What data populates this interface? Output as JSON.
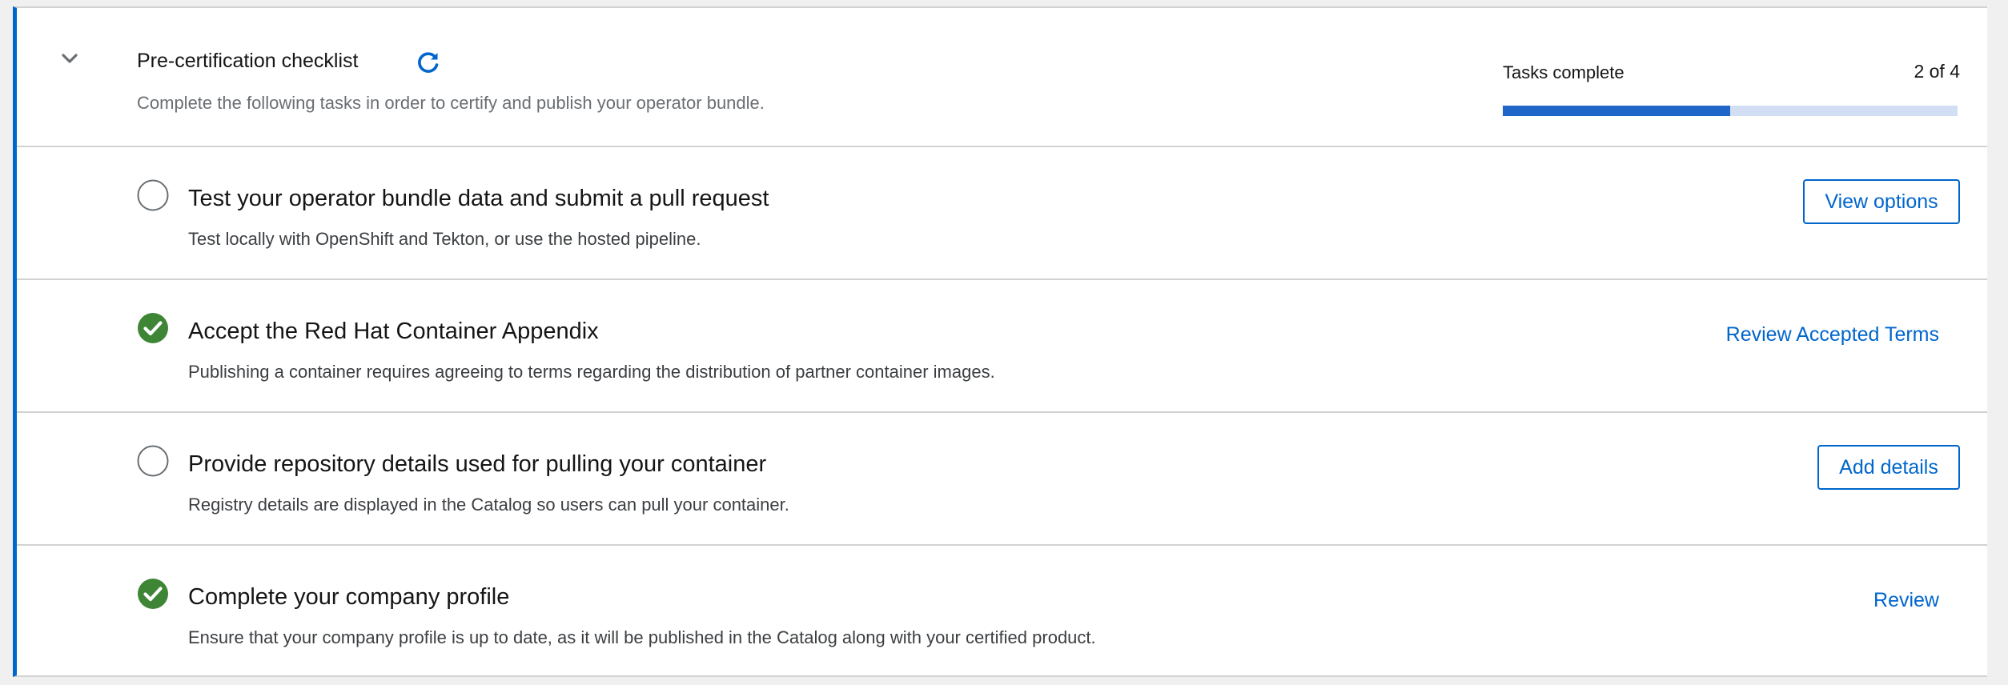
{
  "checklist": {
    "title": "Pre-certification checklist",
    "subtitle": "Complete the following tasks in order to certify and publish your operator bundle.",
    "toggle_icon": "chevron-down-icon",
    "refresh_icon": "refresh-icon",
    "progress": {
      "label": "Tasks complete",
      "count_text": "2 of 4",
      "completed": 2,
      "total": 4
    }
  },
  "tasks": [
    {
      "title": "Test your operator bundle data and submit a pull request",
      "description": "Test locally with OpenShift and Tekton, or use the hosted pipeline.",
      "status": "incomplete",
      "action_label": "View options",
      "action_style": "secondary"
    },
    {
      "title": "Accept the Red Hat Container Appendix",
      "description": "Publishing a container requires agreeing to terms regarding the distribution of partner container images.",
      "status": "complete",
      "action_label": "Review Accepted Terms",
      "action_style": "link"
    },
    {
      "title": "Provide repository details used for pulling your container",
      "description": "Registry details are displayed in the Catalog so users can pull your container.",
      "status": "incomplete",
      "action_label": "Add details",
      "action_style": "secondary"
    },
    {
      "title": "Complete your company profile",
      "description": "Ensure that your company profile is up to date, as it will be published in the Catalog along with your certified product.",
      "status": "complete",
      "action_label": "Review",
      "action_style": "link"
    }
  ],
  "colors": {
    "accent": "#0066cc",
    "success": "#3e8635",
    "progress_fill": "#1f66c8",
    "progress_track": "#d2def4"
  }
}
